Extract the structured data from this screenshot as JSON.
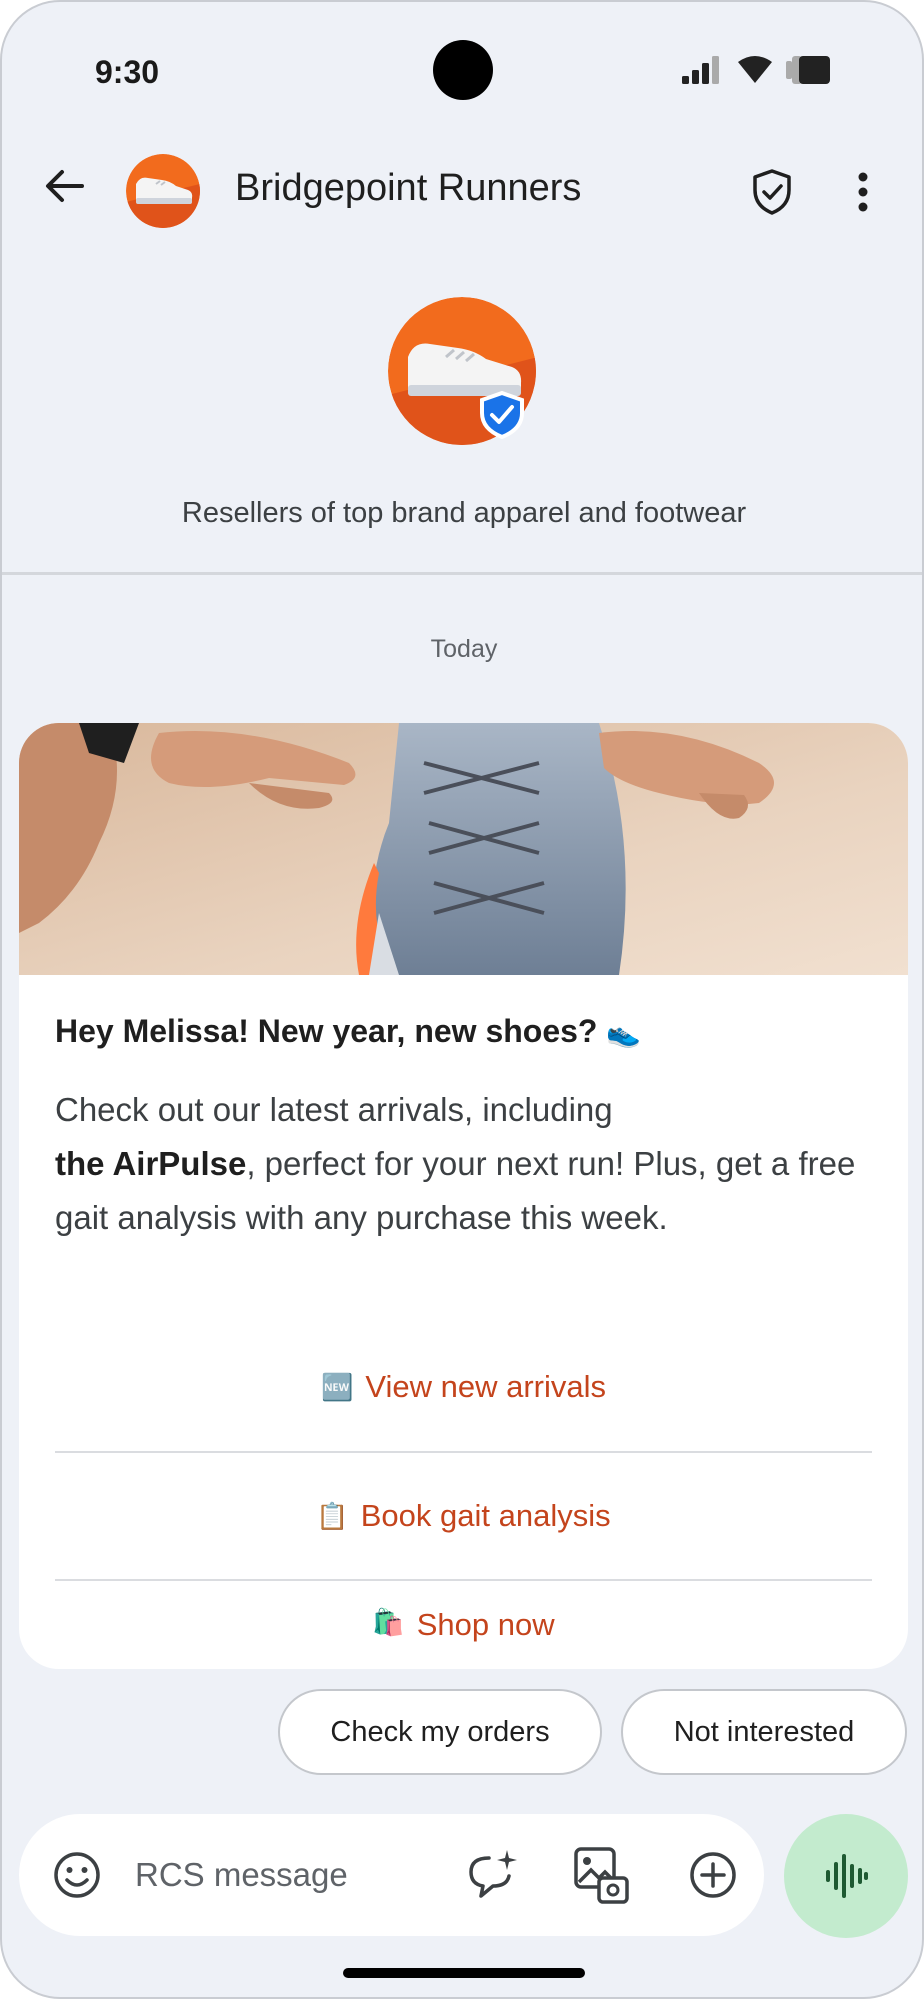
{
  "status_bar": {
    "time": "9:30"
  },
  "header": {
    "title": "Bridgepoint Runners"
  },
  "profile": {
    "description": "Resellers of top brand apparel and footwear"
  },
  "conversation": {
    "day_label": "Today"
  },
  "card": {
    "title": "Hey Melissa! New year, new shoes?",
    "title_emoji": "👟",
    "body_line1": "Check out our latest arrivals, including",
    "body_bold": "the AirPulse",
    "body_rest": ", perfect for your next run! Plus, get a free gait analysis with any purchase this week.",
    "actions": [
      {
        "icon": "🆕",
        "label": "View new arrivals"
      },
      {
        "icon": "📋",
        "label": "Book gait analysis"
      },
      {
        "icon": "🛍️",
        "label": "Shop now"
      }
    ]
  },
  "suggestions": [
    {
      "label": "Check my orders"
    },
    {
      "label": "Not interested"
    }
  ],
  "compose": {
    "placeholder": "RCS message"
  },
  "colors": {
    "brand_orange": "#f26b1d",
    "action_text": "#c4441c",
    "voice_button": "#c3ebce",
    "verified_blue": "#1a73e8"
  }
}
